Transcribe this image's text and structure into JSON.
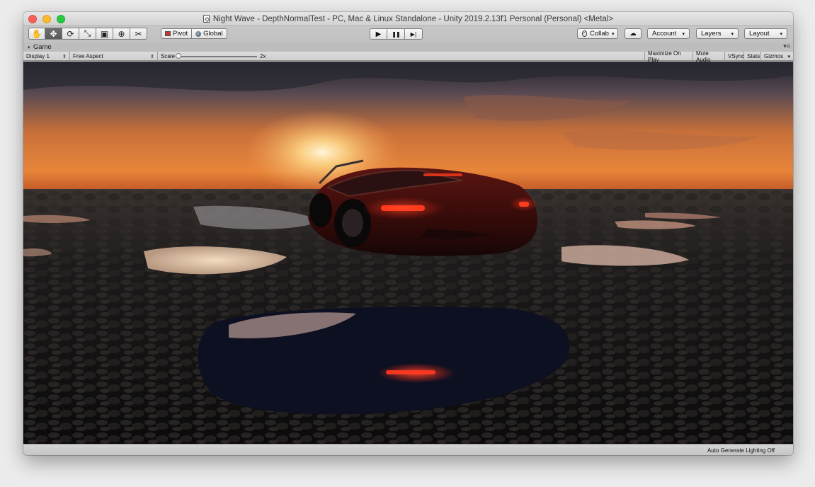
{
  "window": {
    "title": "Night Wave - DepthNormalTest - PC, Mac & Linux Standalone - Unity 2019.2.13f1 Personal (Personal) <Metal>"
  },
  "toolbar": {
    "tools": [
      {
        "name": "hand-tool",
        "glyph": "✋",
        "active": false
      },
      {
        "name": "move-tool",
        "glyph": "✥",
        "active": true
      },
      {
        "name": "rotate-tool",
        "glyph": "⟳",
        "active": false
      },
      {
        "name": "scale-tool",
        "glyph": "⤡",
        "active": false
      },
      {
        "name": "rect-tool",
        "glyph": "▣",
        "active": false
      },
      {
        "name": "transform-tool",
        "glyph": "⊕",
        "active": false
      },
      {
        "name": "custom-tool",
        "glyph": "✂",
        "active": false
      }
    ],
    "pivot_label": "Pivot",
    "global_label": "Global",
    "play_glyph": "▶",
    "pause_glyph": "❚❚",
    "step_glyph": "▶❘",
    "collab_label": "Collab",
    "cloud_glyph": "☁",
    "account_label": "Account",
    "layers_label": "Layers",
    "layout_label": "Layout"
  },
  "tab": {
    "label": "Game",
    "menu_glyph": "▾≡"
  },
  "game_toolbar": {
    "display": "Display 1",
    "aspect": "Free Aspect",
    "scale_label": "Scale",
    "scale_value_text": "2x",
    "scale_level": 0.0,
    "maximize_on_play": "Maximize On Play",
    "mute_audio": "Mute Audio",
    "vsync": "VSync",
    "stats": "Stats",
    "gizmos": "Gizmos"
  },
  "status": {
    "lighting": "Auto Generate Lighting Off"
  },
  "colors": {
    "accent_active_tool": "#5f5f5f",
    "taillight": "#ff2a1a",
    "sky_horizon": "#f5a24a"
  }
}
